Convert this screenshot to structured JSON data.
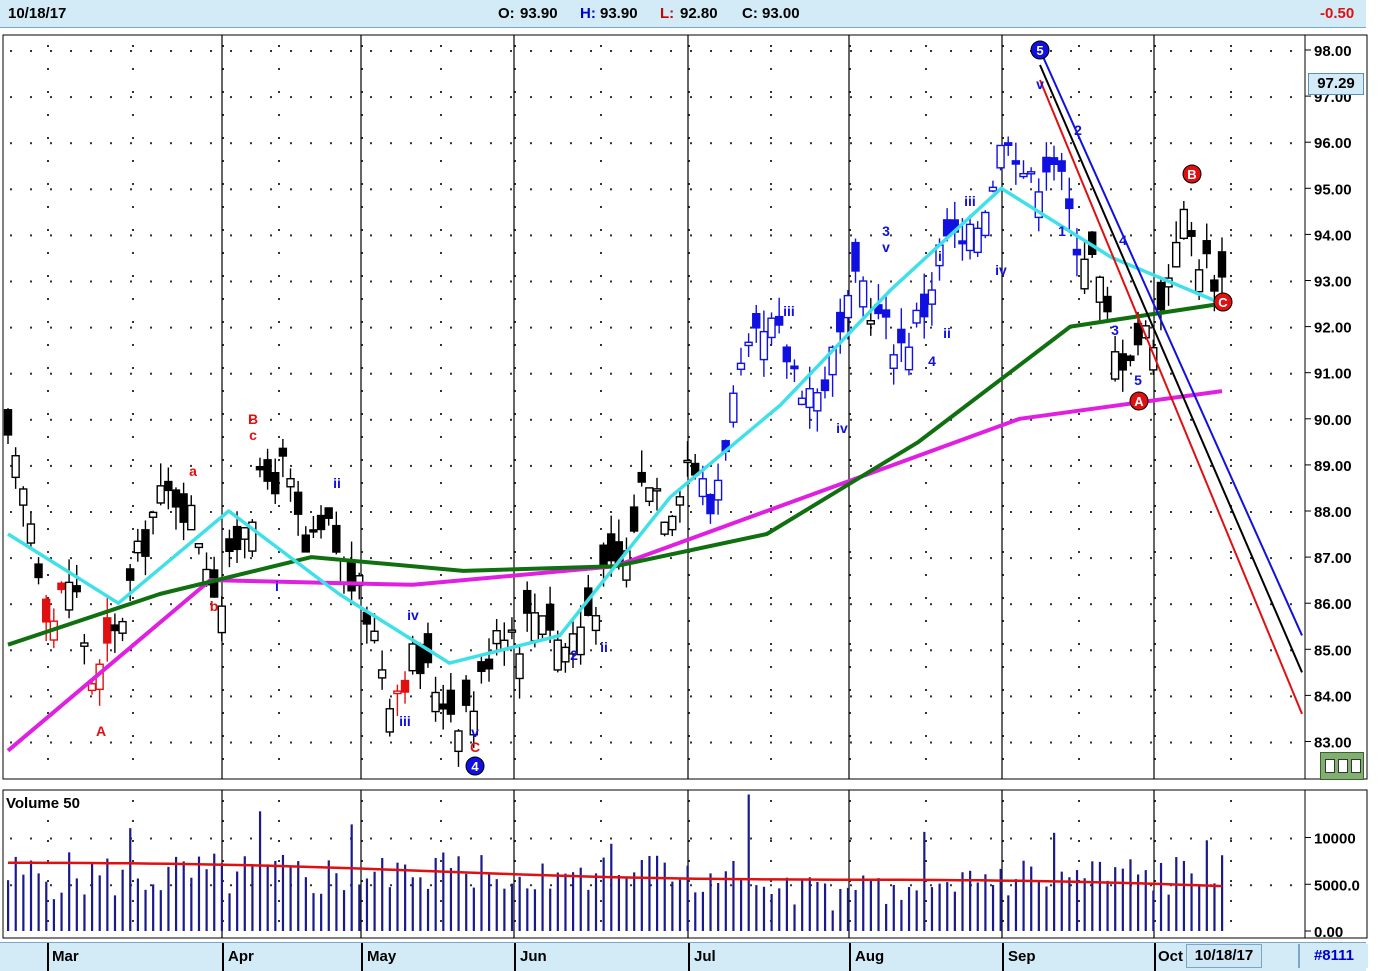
{
  "header": {
    "date": "10/18/17",
    "open_label": "O:",
    "open": "93.90",
    "high_label": "H:",
    "high": "93.90",
    "low_label": "L:",
    "low": "92.80",
    "close_label": "C:",
    "close": "93.00",
    "change": "-0.50"
  },
  "price_panel": {
    "last_price": "97.29",
    "y_ticks": [
      "98.00",
      "97.00",
      "96.00",
      "95.00",
      "94.00",
      "93.00",
      "92.00",
      "91.00",
      "90.00",
      "89.00",
      "88.00",
      "87.00",
      "86.00",
      "85.00",
      "84.00",
      "83.00"
    ]
  },
  "volume_panel": {
    "title": "Volume 50",
    "y_ticks": [
      "10000",
      "5000.0",
      "0.00"
    ]
  },
  "footer": {
    "months": [
      "Mar",
      "Apr",
      "May",
      "Jun",
      "Jul",
      "Aug",
      "Sep",
      "Oct"
    ],
    "cursor_date": "10/18/17",
    "tag": "#8111"
  },
  "colors": {
    "background": "#ffffff",
    "header_bg": "#d3ebf7",
    "down_candle": "#000000",
    "wave_red": "#e01010",
    "wave_blue": "#1010e0",
    "ma_fast": "#40e0e8",
    "ma_mid": "#107010",
    "ma_slow": "#e020e0",
    "volume_bar": "#1a1a8c",
    "volume_avg": "#e01010"
  },
  "chart_data": {
    "type": "candlestick",
    "title": "",
    "ylim": [
      82.3,
      98.5
    ],
    "y_scale": "linear",
    "x_axis": "daily, Feb to Oct 18 2017",
    "grid": true,
    "ohlc_summary": {
      "open": 93.9,
      "high": 93.9,
      "low": 92.8,
      "close": 93.0,
      "change": -0.5
    },
    "close_path": [
      {
        "date": "Feb 21",
        "close": 89.3
      },
      {
        "date": "Mar 1",
        "close": 88.0
      },
      {
        "date": "Mar 6",
        "close": 85.5
      },
      {
        "date": "Mar 10",
        "close": 86.7
      },
      {
        "date": "Mar 14",
        "close": 84.2
      },
      {
        "date": "Mar 17",
        "close": 85.2
      },
      {
        "date": "Mar 22",
        "close": 86.8
      },
      {
        "date": "Mar 27",
        "close": 88.2
      },
      {
        "date": "Mar 31",
        "close": 88.4
      },
      {
        "date": "Apr 4",
        "close": 87.5
      },
      {
        "date": "Apr 7",
        "close": 86.0
      },
      {
        "date": "Apr 12",
        "close": 87.8
      },
      {
        "date": "Apr 18",
        "close": 88.6
      },
      {
        "date": "Apr 21",
        "close": 88.9
      },
      {
        "date": "Apr 26",
        "close": 87.0
      },
      {
        "date": "May 1",
        "close": 87.6
      },
      {
        "date": "May 4",
        "close": 86.6
      },
      {
        "date": "May 8",
        "close": 85.7
      },
      {
        "date": "May 12",
        "close": 84.0
      },
      {
        "date": "May 16",
        "close": 84.8
      },
      {
        "date": "May 19",
        "close": 84.3
      },
      {
        "date": "May 24",
        "close": 83.6
      },
      {
        "date": "May 26",
        "close": 83.9
      },
      {
        "date": "May 31",
        "close": 85.7
      },
      {
        "date": "Jun 5",
        "close": 85.3
      },
      {
        "date": "Jun 9",
        "close": 86.1
      },
      {
        "date": "Jun 14",
        "close": 85.0
      },
      {
        "date": "Jun 19",
        "close": 85.6
      },
      {
        "date": "Jun 23",
        "close": 86.5
      },
      {
        "date": "Jun 28",
        "close": 87.0
      },
      {
        "date": "Jul 3",
        "close": 89.0
      },
      {
        "date": "Jul 7",
        "close": 88.0
      },
      {
        "date": "Jul 12",
        "close": 89.3
      },
      {
        "date": "Jul 17",
        "close": 88.0
      },
      {
        "date": "Jul 20",
        "close": 90.3
      },
      {
        "date": "Jul 25",
        "close": 91.5
      },
      {
        "date": "Jul 28",
        "close": 91.9
      },
      {
        "date": "Aug 2",
        "close": 91.0
      },
      {
        "date": "Aug 7",
        "close": 90.5
      },
      {
        "date": "Aug 10",
        "close": 91.6
      },
      {
        "date": "Aug 15",
        "close": 93.1
      },
      {
        "date": "Aug 18",
        "close": 92.0
      },
      {
        "date": "Aug 23",
        "close": 91.6
      },
      {
        "date": "Aug 28",
        "close": 92.4
      },
      {
        "date": "Aug 31",
        "close": 94.0
      },
      {
        "date": "Sep 5",
        "close": 93.6
      },
      {
        "date": "Sep 8",
        "close": 94.9
      },
      {
        "date": "Sep 12",
        "close": 96.4
      },
      {
        "date": "Sep 15",
        "close": 95.0
      },
      {
        "date": "Sep 20",
        "close": 95.9
      },
      {
        "date": "Sep 22",
        "close": 94.1
      },
      {
        "date": "Sep 27",
        "close": 93.4
      },
      {
        "date": "Oct 2",
        "close": 91.3
      },
      {
        "date": "Oct 5",
        "close": 91.7
      },
      {
        "date": "Oct 9",
        "close": 92.0
      },
      {
        "date": "Oct 12",
        "close": 94.5
      },
      {
        "date": "Oct 16",
        "close": 93.5
      },
      {
        "date": "Oct 18",
        "close": 93.0
      }
    ],
    "moving_averages": [
      {
        "color": "cyan",
        "values_approx": [
          87.5,
          86.0,
          88.0,
          86.2,
          84.7,
          85.3,
          88.3,
          90.3,
          92.8,
          95.0,
          93.5,
          92.5
        ]
      },
      {
        "color": "green",
        "values_approx": [
          85.1,
          86.2,
          87.0,
          86.7,
          86.8,
          87.5,
          89.5,
          92.0,
          92.5
        ]
      },
      {
        "color": "magenta",
        "values_approx": [
          82.8,
          86.5,
          86.4,
          86.8,
          88.4,
          90.0,
          90.6
        ]
      }
    ],
    "trendlines_from_peak_5": [
      {
        "color": "blue",
        "from": 98.0,
        "to_end": 85.3
      },
      {
        "color": "black",
        "from": 98.0,
        "to_end": 84.5
      },
      {
        "color": "red",
        "from": 98.0,
        "to_end": 83.6
      }
    ],
    "wave_labels": {
      "red": [
        "A",
        "a",
        "b",
        "B",
        "c",
        "C",
        "A",
        "B",
        "C"
      ],
      "blue": [
        "i",
        "ii",
        "iii",
        "iv",
        "v",
        "4",
        "2",
        "ii",
        "iii",
        "iv",
        "3",
        "v",
        "4",
        "ii",
        "i",
        "iii",
        "iv",
        "v",
        "5",
        "1",
        "2",
        "3",
        "4",
        "5"
      ]
    },
    "volume": {
      "title": "Volume 50",
      "ylim": [
        0,
        14000
      ],
      "average_line_approx": 5500
    }
  }
}
